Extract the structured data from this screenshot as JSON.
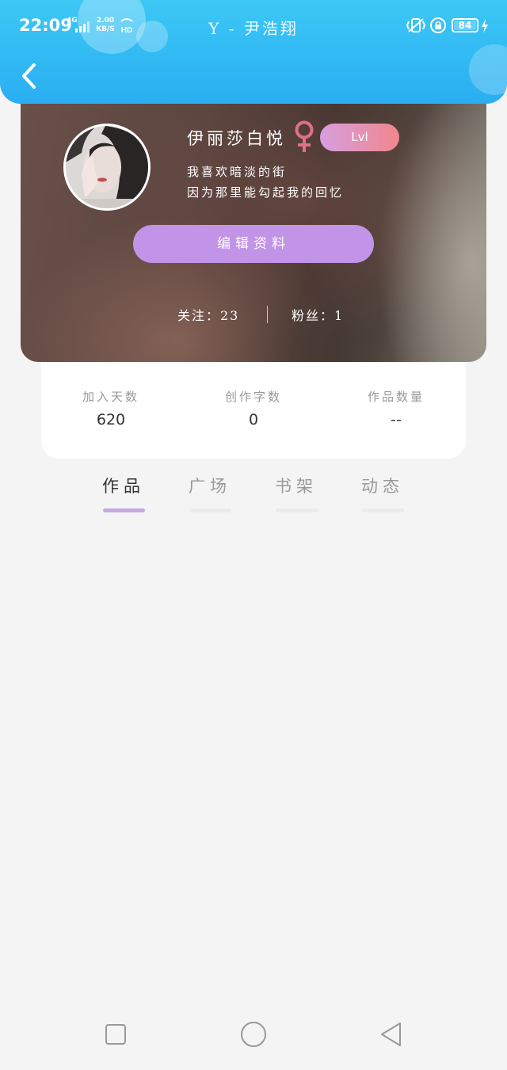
{
  "status_bar": {
    "time": "22:09",
    "network_tag": "4G",
    "net_speed_value": "2.00",
    "net_speed_unit": "KB/S",
    "hd_label": "HD",
    "battery_level": "84"
  },
  "header": {
    "title": "Y - 尹浩翔"
  },
  "profile": {
    "username": "伊丽莎白悦",
    "level": "Lvl",
    "bio_line1": "我喜欢暗淡的街",
    "bio_line2": "因为那里能勾起我的回忆",
    "edit_label": "编辑资料",
    "following_label": "关注：23",
    "fans_label": "粉丝：1"
  },
  "stats": [
    {
      "label": "加入天数",
      "value": "620"
    },
    {
      "label": "创作字数",
      "value": "0"
    },
    {
      "label": "作品数量",
      "value": "--"
    }
  ],
  "tabs": [
    {
      "label": "作品",
      "active": true
    },
    {
      "label": "广场",
      "active": false
    },
    {
      "label": "书架",
      "active": false
    },
    {
      "label": "动态",
      "active": false
    }
  ],
  "colors": {
    "header_blue": "#2aaef2",
    "edit_button": "#c294e8",
    "active_tab_underline": "#c8a8e0",
    "gender_icon": "#e0708a"
  },
  "icons": {
    "back": "chevron-left-icon",
    "gender": "female-icon",
    "nav_recent": "square-icon",
    "nav_home": "circle-icon",
    "nav_back": "triangle-back-icon"
  }
}
